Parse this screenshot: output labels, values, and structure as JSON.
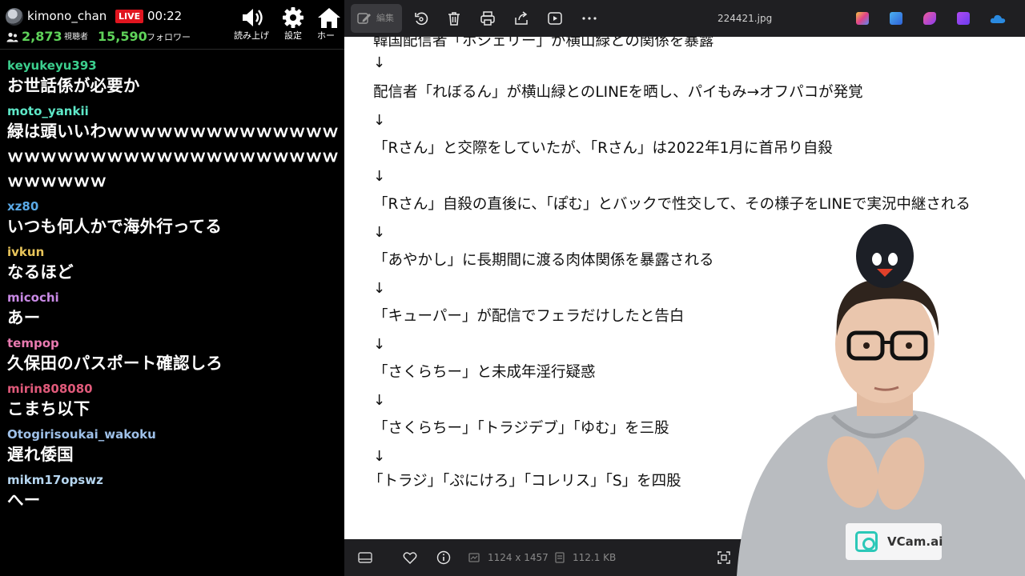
{
  "stream": {
    "channel_name": "kimono_chan",
    "live_label": "LIVE",
    "elapsed": "00:22",
    "viewers": "2,873",
    "viewers_label": "視聴者",
    "followers": "15,590",
    "followers_label": "フォロワー",
    "buttons": [
      {
        "label": "読み上げ",
        "icon": "speaker-icon"
      },
      {
        "label": "設定",
        "icon": "gear-icon"
      },
      {
        "label": "ホー",
        "icon": "home-icon"
      }
    ]
  },
  "chat": [
    {
      "user": "keyukeyu393",
      "color": "#3ccf8e",
      "message": "お世話係が必要か"
    },
    {
      "user": "moto_yankii",
      "color": "#5ee8c8",
      "message": "緑は頭いいわｗｗｗｗｗｗｗｗｗｗｗｗｗｗｗｗｗｗｗｗｗｗｗｗｗｗｗｗｗｗｗｗｗｗｗｗｗｗｗｗ"
    },
    {
      "user": "xz80",
      "color": "#5aa9e6",
      "message": "いつも何人かで海外行ってる"
    },
    {
      "user": "ivkun",
      "color": "#e8c45a",
      "message": "なるほど"
    },
    {
      "user": "micochi",
      "color": "#c98ae6",
      "message": "あー"
    },
    {
      "user": "tempop",
      "color": "#e87ab0",
      "message": "久保田のパスポート確認しろ"
    },
    {
      "user": "mirin808080",
      "color": "#e05a7a",
      "message": "こまち以下"
    },
    {
      "user": "Otogirisoukai_wakoku",
      "color": "#9ec0e8",
      "message": "遅れ倭国"
    },
    {
      "user": "mikm17opswz",
      "color": "#b6d6f0",
      "message": "へー"
    }
  ],
  "viewer": {
    "edit_label": "編集",
    "filename": "224421.jpg",
    "dimensions": "1124 x 1457",
    "filesize": "112.1 KB",
    "app_colors": [
      "#d24af0",
      "#2f86e8",
      "#e0428a",
      "#8a3cf0",
      "#2a8ae0"
    ]
  },
  "document": {
    "lines": [
      {
        "text": "韓国配信者「ホシェリー」が横山緑との関係を暴露",
        "kind": "line"
      },
      {
        "text": "↓",
        "kind": "arrow"
      },
      {
        "text": "配信者「れぼるん」が横山緑とのLINEを晒し、パイもみ→オフパコが発覚",
        "kind": "line"
      },
      {
        "text": "↓",
        "kind": "arrow"
      },
      {
        "text": "「Rさん」と交際をしていたが、「Rさん」は2022年1月に首吊り自殺",
        "kind": "line"
      },
      {
        "text": "↓",
        "kind": "arrow"
      },
      {
        "text": "「Rさん」自殺の直後に、「ぽむ」とバックで性交して、その様子をLINEで実況中継される",
        "kind": "line"
      },
      {
        "text": "↓",
        "kind": "arrow"
      },
      {
        "text": "「あやかし」に長期間に渡る肉体関係を暴露される",
        "kind": "line"
      },
      {
        "text": "↓",
        "kind": "arrow"
      },
      {
        "text": "「キューパー」が配信でフェラだけしたと告白",
        "kind": "line"
      },
      {
        "text": "↓",
        "kind": "arrow"
      },
      {
        "text": "「さくらちー」と未成年淫行疑惑",
        "kind": "line"
      },
      {
        "text": "↓",
        "kind": "arrow"
      },
      {
        "text": "「さくらちー」「トラジデブ」「ゆむ」を三股",
        "kind": "line"
      },
      {
        "text": "↓",
        "kind": "arrow"
      },
      {
        "text": "「トラジ」「ぷにけろ」「コレリス」「S」を四股",
        "kind": "line"
      }
    ]
  },
  "overlay": {
    "brand": "VCam.ai"
  }
}
